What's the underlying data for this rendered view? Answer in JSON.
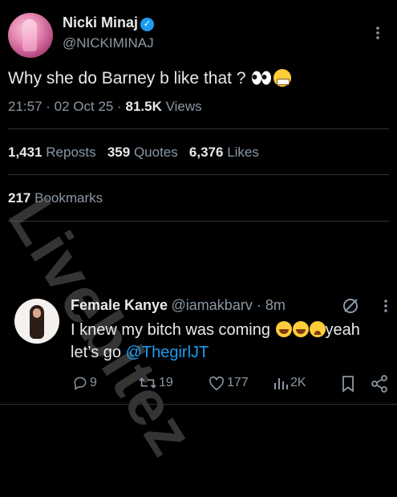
{
  "main_tweet": {
    "display_name": "Nicki Minaj",
    "handle": "@NICKIMINAJ",
    "more_icon": "more-vertical-icon",
    "text": "Why she do Barney b like that ?",
    "emojis": [
      "eyes-emoji",
      "grimacing-emoji"
    ],
    "time": "21:57",
    "date": "02 Oct 25",
    "views_count": "81.5K",
    "views_label": "Views",
    "reposts_count": "1,431",
    "reposts_label": "Reposts",
    "quotes_count": "359",
    "quotes_label": "Quotes",
    "likes_count": "6,376",
    "likes_label": "Likes",
    "bookmarks_count": "217",
    "bookmarks_label": "Bookmarks"
  },
  "watermark": "Livebitez",
  "reply": {
    "display_name": "Female Kanye",
    "handle": "@iamakbarv",
    "age": "8m",
    "text_part1": "I knew my bitch was coming",
    "text_part2": "yeah let’s go",
    "mention": "@ThegirlJT",
    "reply_count": "9",
    "repost_count": "19",
    "like_count": "177",
    "view_count": "2K"
  },
  "colors": {
    "background": "#000000",
    "text": "#e7e9ea",
    "secondary": "#8b98a5",
    "accent": "#1d9bf0",
    "divider": "#2f3336"
  }
}
